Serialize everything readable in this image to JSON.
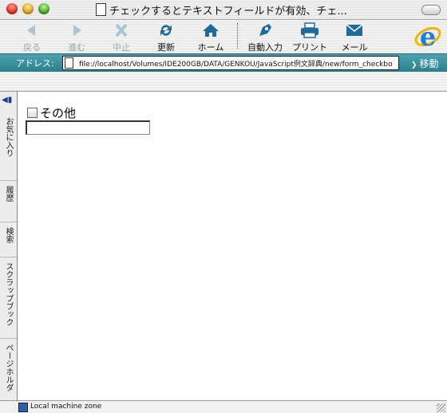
{
  "window": {
    "title": "チェックするとテキストフィールドが有効、チェ..."
  },
  "toolbar": {
    "buttons": [
      {
        "label": "戻る",
        "icon": "back-arrow-icon",
        "enabled": false
      },
      {
        "label": "進む",
        "icon": "forward-arrow-icon",
        "enabled": false
      },
      {
        "label": "中止",
        "icon": "stop-x-icon",
        "enabled": false
      },
      {
        "label": "更新",
        "icon": "refresh-icon",
        "enabled": true
      },
      {
        "label": "ホーム",
        "icon": "home-icon",
        "enabled": true
      },
      {
        "label": "自動入力",
        "icon": "autofill-icon",
        "enabled": true
      },
      {
        "label": "プリント",
        "icon": "printer-icon",
        "enabled": true
      },
      {
        "label": "メール",
        "icon": "mail-icon",
        "enabled": true
      }
    ]
  },
  "address_bar": {
    "label": "アドレス:",
    "url": "file://localhost/Volumes/IDE200GB/DATA/GENKOU/JavaScript例文辞典/new/form_checkbo",
    "go_label": "移動"
  },
  "sidebar": {
    "tabs": [
      "お気に入り",
      "履歴",
      "検索",
      "スクラップブック",
      "ページホルダ"
    ]
  },
  "content": {
    "checkbox_label": "その他",
    "checkbox_checked": false,
    "text_value": ""
  },
  "status": {
    "zone": "Local machine zone"
  },
  "colors": {
    "address_bar": "#2b7f8c",
    "accent_icon": "#1f6b9e"
  }
}
